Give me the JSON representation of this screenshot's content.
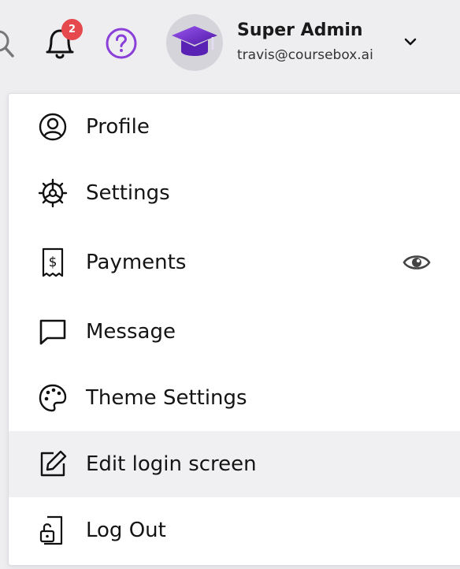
{
  "header": {
    "notifications_count": "2",
    "user": {
      "name": "Super Admin",
      "email": "travis@coursebox.ai"
    }
  },
  "menu": {
    "items": [
      {
        "label": "Profile",
        "icon": "profile-icon"
      },
      {
        "label": "Settings",
        "icon": "settings-icon"
      },
      {
        "label": "Payments",
        "icon": "payments-icon",
        "has_eye": true
      },
      {
        "label": "Message",
        "icon": "message-icon"
      },
      {
        "label": "Theme Settings",
        "icon": "palette-icon"
      },
      {
        "label": "Edit login screen",
        "icon": "edit-icon",
        "highlighted": true
      },
      {
        "label": "Log Out",
        "icon": "logout-icon"
      }
    ]
  },
  "colors": {
    "accent_purple": "#7b3fd6",
    "badge_red": "#e5484d",
    "highlight_bg": "#f0f0f2"
  }
}
